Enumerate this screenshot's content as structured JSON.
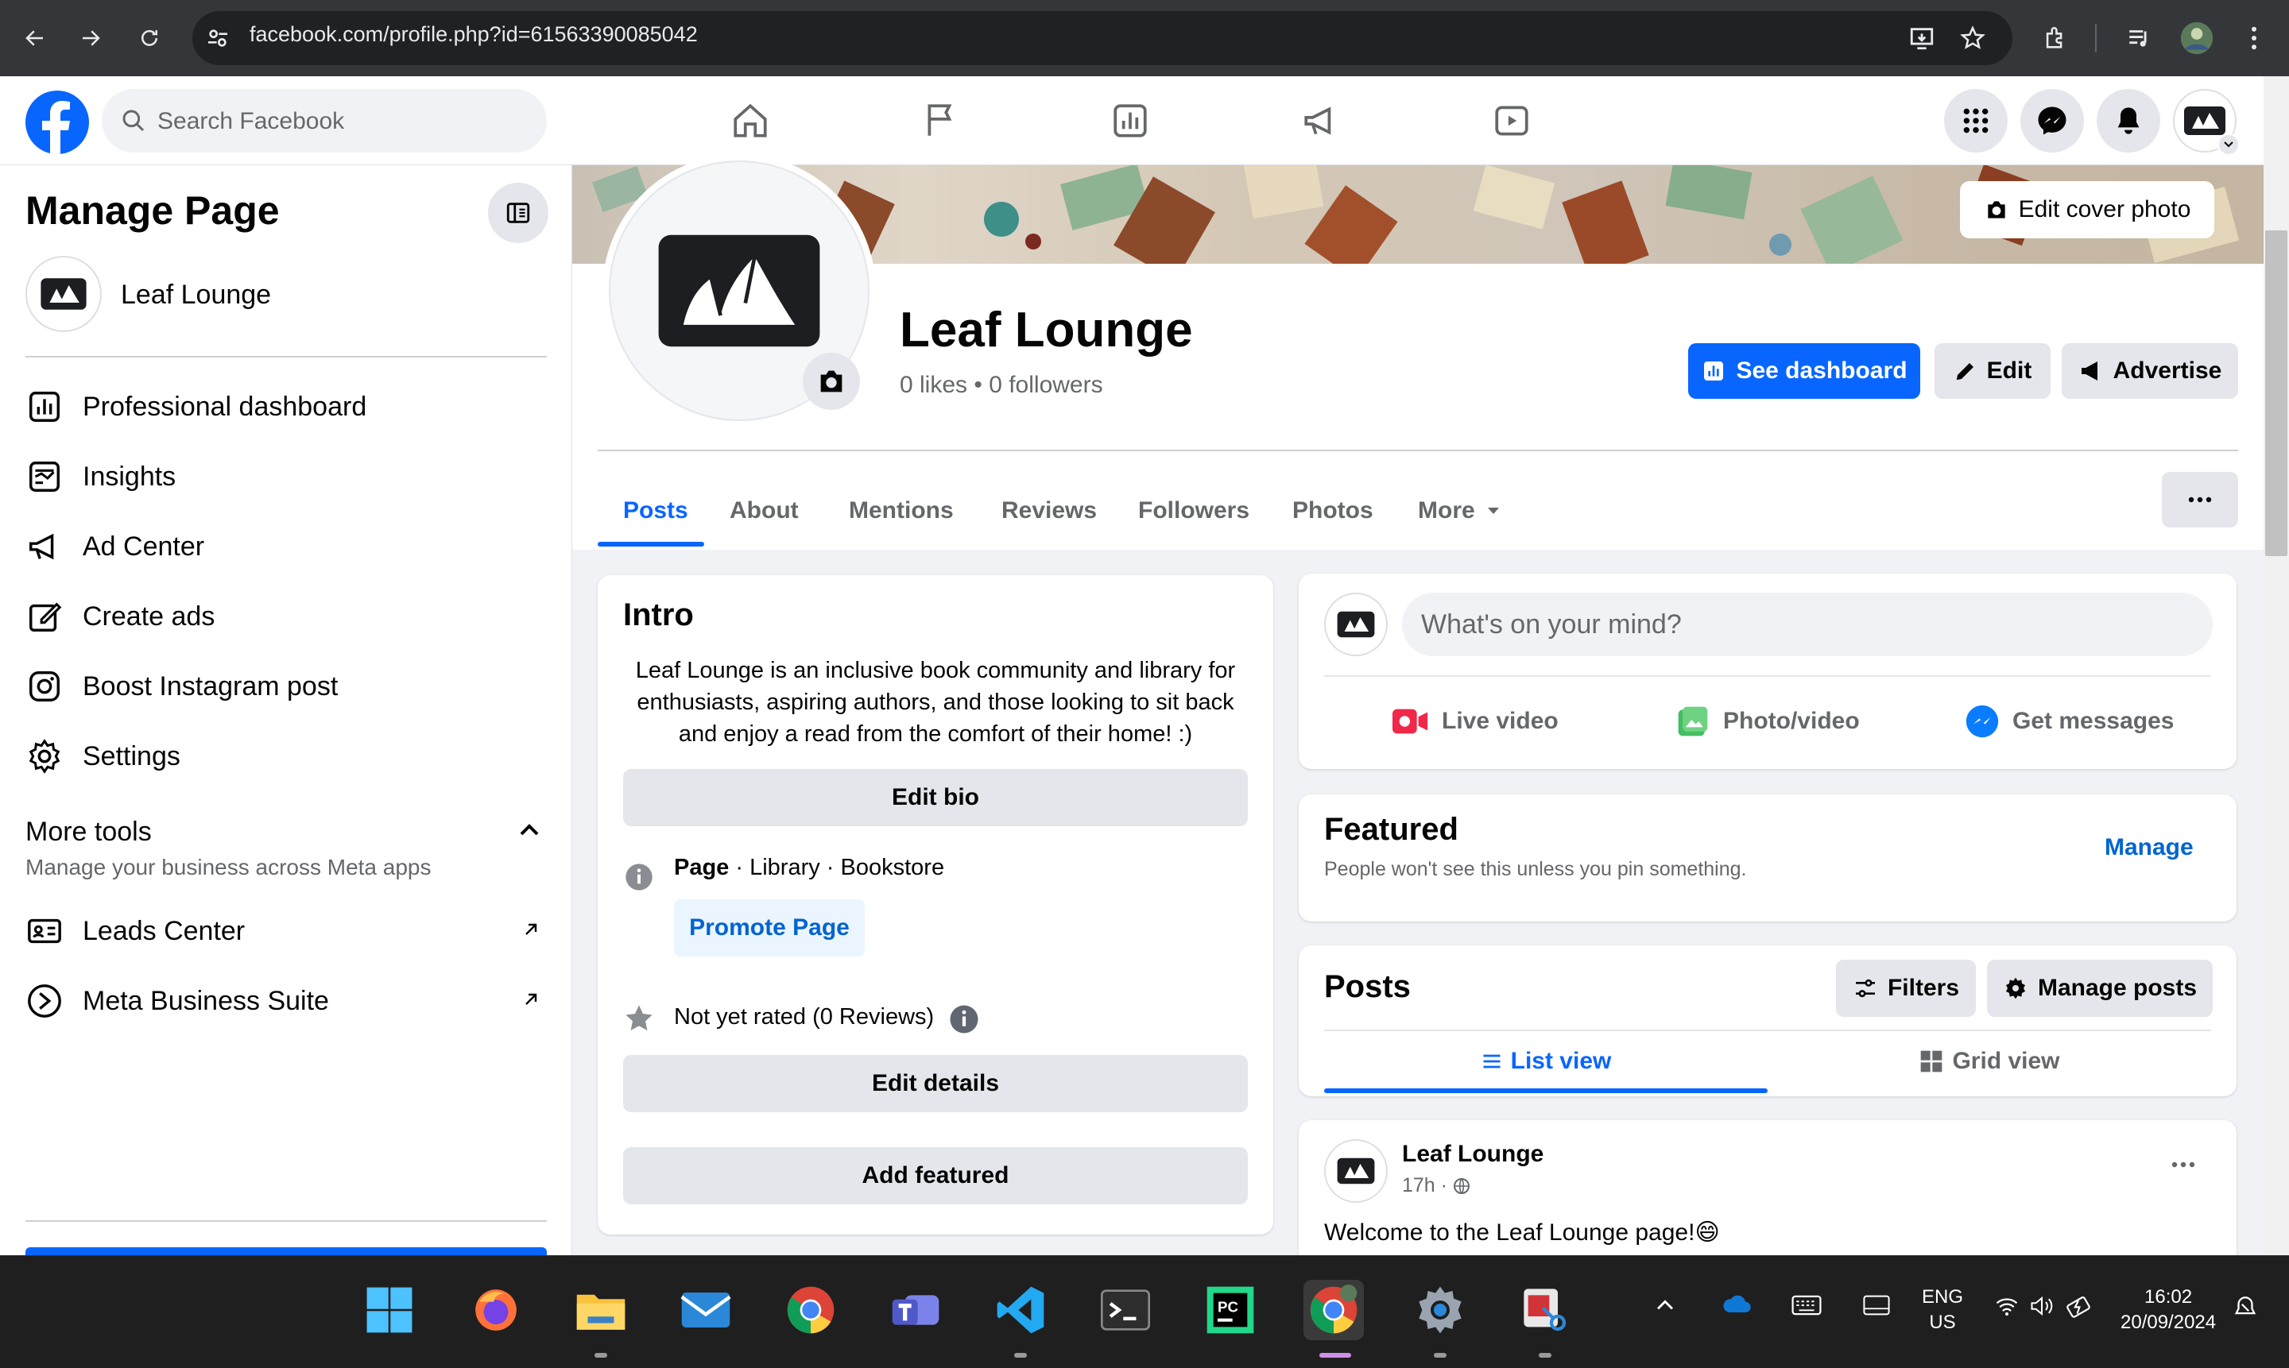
{
  "browser": {
    "url": "facebook.com/profile.php?id=61563390085042"
  },
  "fb_header": {
    "search_placeholder": "Search Facebook"
  },
  "sidebar": {
    "title": "Manage Page",
    "page_name": "Leaf Lounge",
    "items": [
      {
        "label": "Professional dashboard",
        "icon": "dashboard-icon"
      },
      {
        "label": "Insights",
        "icon": "insights-icon"
      },
      {
        "label": "Ad Center",
        "icon": "megaphone-icon"
      },
      {
        "label": "Create ads",
        "icon": "edit-icon"
      },
      {
        "label": "Boost Instagram post",
        "icon": "instagram-icon"
      },
      {
        "label": "Settings",
        "icon": "gear-icon"
      }
    ],
    "more_tools_title": "More tools",
    "more_tools_subtitle": "Manage your business across Meta apps",
    "tools": [
      {
        "label": "Leads Center",
        "icon": "leads-icon"
      },
      {
        "label": "Meta Business Suite",
        "icon": "meta-business-icon"
      }
    ]
  },
  "profile": {
    "edit_cover_label": "Edit cover photo",
    "name": "Leaf Lounge",
    "stats": "0 likes • 0 followers",
    "see_dashboard_label": "See dashboard",
    "edit_label": "Edit",
    "advertise_label": "Advertise"
  },
  "tabs": [
    "Posts",
    "About",
    "Mentions",
    "Reviews",
    "Followers",
    "Photos",
    "More"
  ],
  "intro": {
    "title": "Intro",
    "bio": "Leaf Lounge is an inclusive book community and library for enthusiasts, aspiring authors, and those looking to sit back and enjoy a read from the comfort of their home! :)",
    "edit_bio_label": "Edit bio",
    "category_prefix": "Page",
    "category_rest": " · Library · Bookstore",
    "promote_label": "Promote Page",
    "rating": "Not yet rated (0 Reviews)",
    "edit_details_label": "Edit details",
    "add_featured_label": "Add featured"
  },
  "composer": {
    "placeholder": "What's on your mind?",
    "live_video": "Live video",
    "photo_video": "Photo/video",
    "get_messages": "Get messages"
  },
  "featured": {
    "title": "Featured",
    "subtitle": "People won't see this unless you pin something.",
    "manage_label": "Manage"
  },
  "posts": {
    "title": "Posts",
    "filters_label": "Filters",
    "manage_posts_label": "Manage posts",
    "list_view": "List view",
    "grid_view": "Grid view"
  },
  "post": {
    "author": "Leaf Lounge",
    "time": "17h ·",
    "text": "Welcome to the Leaf Lounge page!😄"
  },
  "taskbar": {
    "lang_line1": "ENG",
    "lang_line2": "US",
    "time": "16:02",
    "date": "20/09/2024"
  },
  "colors": {
    "fb_blue": "#0866ff",
    "brand_dark": "#1c1e21"
  }
}
